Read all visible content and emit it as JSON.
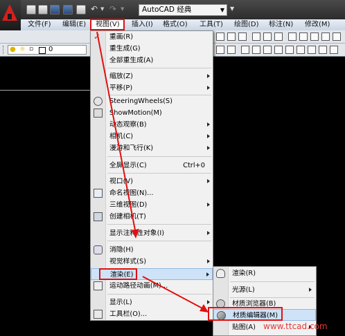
{
  "quick_access": {
    "workspace": "AutoCAD 经典",
    "icons": [
      "new-file-icon",
      "open-file-icon",
      "save-icon",
      "save-as-icon",
      "print-icon",
      "undo-icon",
      "undo-dropdown-icon",
      "redo-icon",
      "redo-dropdown-icon"
    ]
  },
  "menubar": {
    "items": [
      "文件(F)",
      "编辑(E)",
      "视图(V)",
      "插入(I)",
      "格式(O)",
      "工具(T)",
      "绘图(D)",
      "标注(N)",
      "修改(M)"
    ]
  },
  "layer_toolbar": {
    "layer_name": "0"
  },
  "view_menu": {
    "items": [
      {
        "label": "重画(R)"
      },
      {
        "label": "重生成(G)"
      },
      {
        "label": "全部重生成(A)"
      },
      {
        "label": "缩放(Z)"
      },
      {
        "label": "平移(P)"
      },
      {
        "label": "SteeringWheels(S)"
      },
      {
        "label": "ShowMotion(M)"
      },
      {
        "label": "动态观察(B)"
      },
      {
        "label": "相机(C)"
      },
      {
        "label": "漫游和飞行(K)"
      },
      {
        "label": "全屏显示(C)",
        "shortcut": "Ctrl+0"
      },
      {
        "label": "视口(V)"
      },
      {
        "label": "命名视图(N)..."
      },
      {
        "label": "三维视图(D)"
      },
      {
        "label": "创建相机(T)"
      },
      {
        "label": "显示注释性对象(I)"
      },
      {
        "label": "消隐(H)"
      },
      {
        "label": "视觉样式(S)"
      },
      {
        "label": "渲染(E)"
      },
      {
        "label": "运动路径动画(M)..."
      },
      {
        "label": "显示(L)"
      },
      {
        "label": "工具栏(O)..."
      }
    ]
  },
  "render_submenu": {
    "items": [
      {
        "label": "渲染(R)"
      },
      {
        "label": "光源(L)"
      },
      {
        "label": "材质浏览器(B)"
      },
      {
        "label": "材质编辑器(M)"
      },
      {
        "label": "贴图(A)"
      }
    ]
  },
  "watermark": "www.ttcad.com",
  "colors": {
    "highlight_box": "#e01010",
    "arrow": "#e01010",
    "menu_hover": "#cfe3f8",
    "logo": "#d4201e"
  }
}
